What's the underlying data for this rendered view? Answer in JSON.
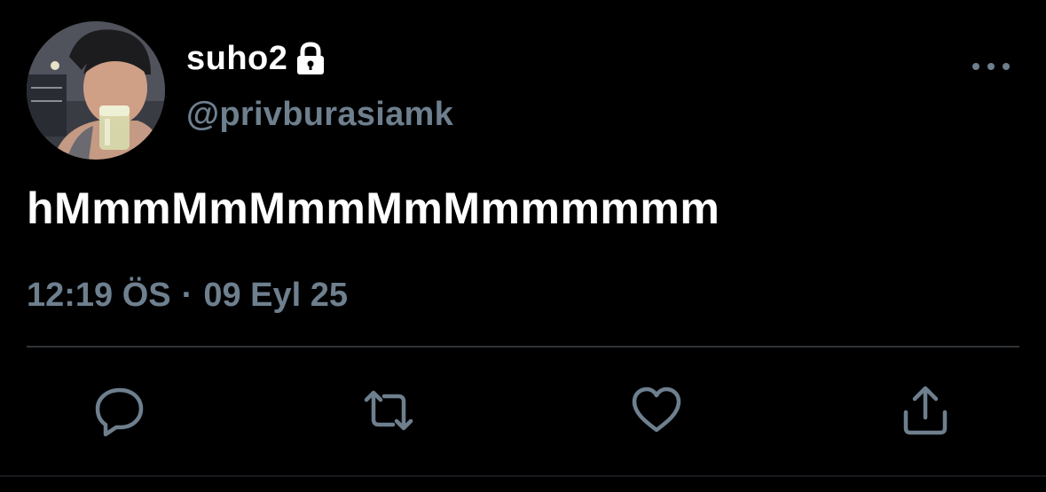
{
  "tweet": {
    "display_name": "suho2",
    "handle": "@privburasiamk",
    "text": "hMmmMmMmmMmMmmmmmm",
    "time": "12:19 ÖS",
    "separator": "·",
    "date": "09 Eyl 25"
  },
  "icons": {
    "lock": "lock-icon",
    "more": "more-horizontal-icon",
    "reply": "reply-icon",
    "retweet": "retweet-icon",
    "like": "heart-icon",
    "share": "share-icon"
  },
  "colors": {
    "background": "#000000",
    "primary_text": "#ffffff",
    "secondary_text": "#6e7f8e",
    "divider": "#2f3336"
  }
}
